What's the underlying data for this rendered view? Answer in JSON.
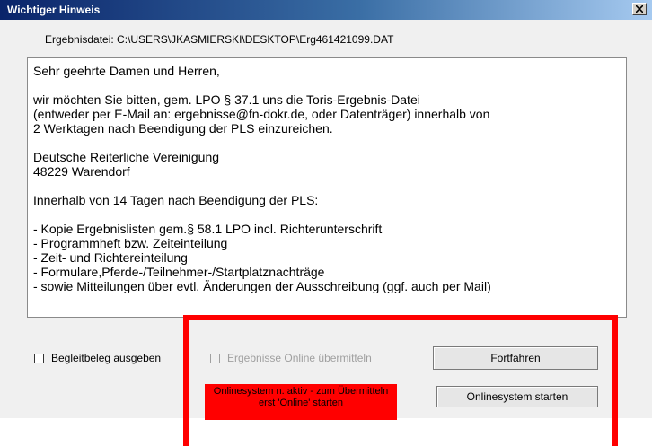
{
  "window": {
    "title": "Wichtiger Hinweis",
    "close_icon": "close-icon"
  },
  "file": {
    "label": "Ergebnisdatei: C:\\USERS\\JKASMIERSKI\\DESKTOP\\Erg461421099.DAT"
  },
  "memo": {
    "lines": [
      "Sehr geehrte Damen und Herren,",
      "",
      "wir möchten Sie bitten, gem. LPO § 37.1 uns die Toris-Ergebnis-Datei",
      "(entweder per E-Mail an: ergebnisse@fn-dokr.de, oder Datenträger) innerhalb von",
      "2 Werktagen nach Beendigung der PLS einzureichen.",
      "",
      "Deutsche Reiterliche Vereinigung",
      "48229 Warendorf",
      "",
      "Innerhalb von 14 Tagen nach Beendigung der PLS:",
      "",
      "- Kopie Ergebnislisten gem.§ 58.1 LPO incl. Richterunterschrift",
      "- Programmheft bzw. Zeiteinteilung",
      "- Zeit- und Richtereinteilung",
      "- Formulare,Pferde-/Teilnehmer-/Startplatznachträge",
      "- sowie Mitteilungen über evtl. Änderungen der Ausschreibung (ggf. auch per Mail)"
    ]
  },
  "options": {
    "begleitbeleg_label": "Begleitbeleg ausgeben",
    "online_label": "Ergebnisse Online übermitteln"
  },
  "buttons": {
    "continue_label": "Fortfahren",
    "start_online_label": "Onlinesystem starten"
  },
  "status": {
    "line1": "Onlinesystem n. aktiv - zum Übermitteln",
    "line2": "erst 'Online' starten",
    "color": "#ff0000"
  },
  "colors": {
    "title_bar": "#0a246a",
    "highlight": "#ff0000",
    "dialog_bg": "#f0f0f0"
  }
}
